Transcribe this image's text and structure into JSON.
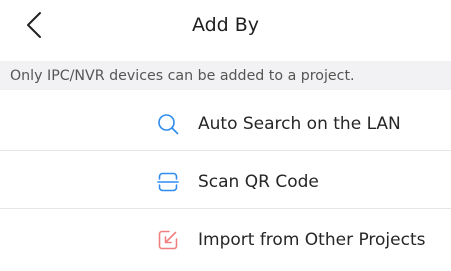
{
  "header": {
    "title": "Add By",
    "back_icon": "chevron-left-icon"
  },
  "notice": {
    "text": "Only IPC/NVR devices can be added to a project."
  },
  "options": [
    {
      "label": "Auto Search on the LAN",
      "icon": "search-icon",
      "icon_color": "#2f8cf0"
    },
    {
      "label": "Scan QR Code",
      "icon": "scan-icon",
      "icon_color": "#2f8cf0"
    },
    {
      "label": "Import from Other Projects",
      "icon": "import-icon",
      "icon_color": "#f08080"
    }
  ],
  "colors": {
    "background": "#ffffff",
    "notice_background": "#f2f2f4",
    "divider": "#e6e6e6",
    "accent_blue": "#2f8cf0",
    "accent_red": "#f08080"
  }
}
